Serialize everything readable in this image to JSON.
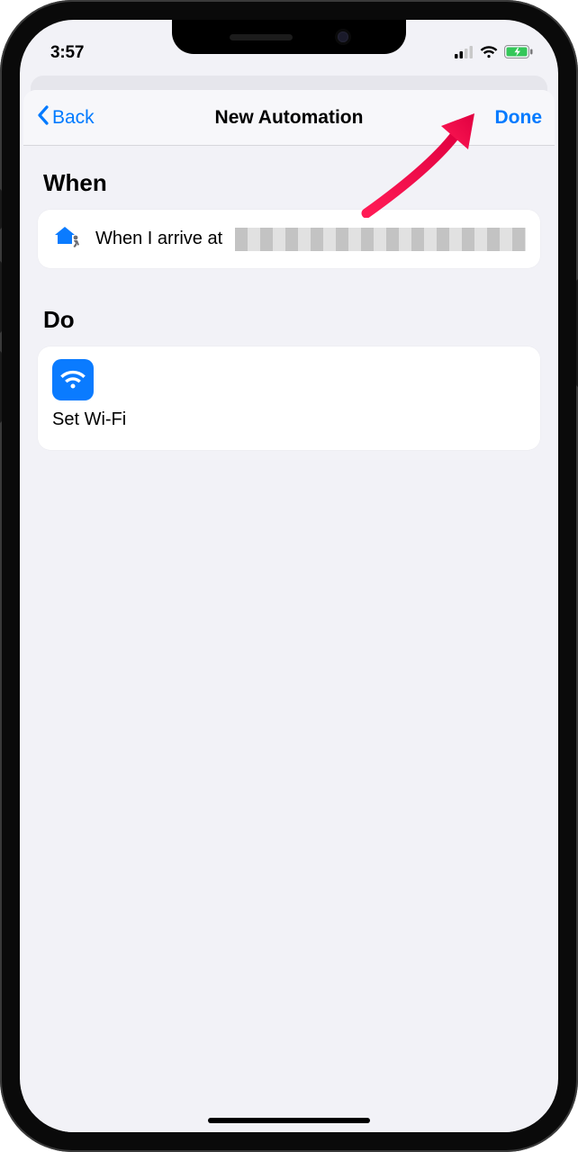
{
  "status": {
    "time": "3:57"
  },
  "nav": {
    "back_label": "Back",
    "title": "New Automation",
    "done_label": "Done"
  },
  "sections": {
    "when": {
      "header": "When",
      "item_prefix": "When I arrive at "
    },
    "do": {
      "header": "Do",
      "action_label": "Set Wi-Fi"
    }
  }
}
